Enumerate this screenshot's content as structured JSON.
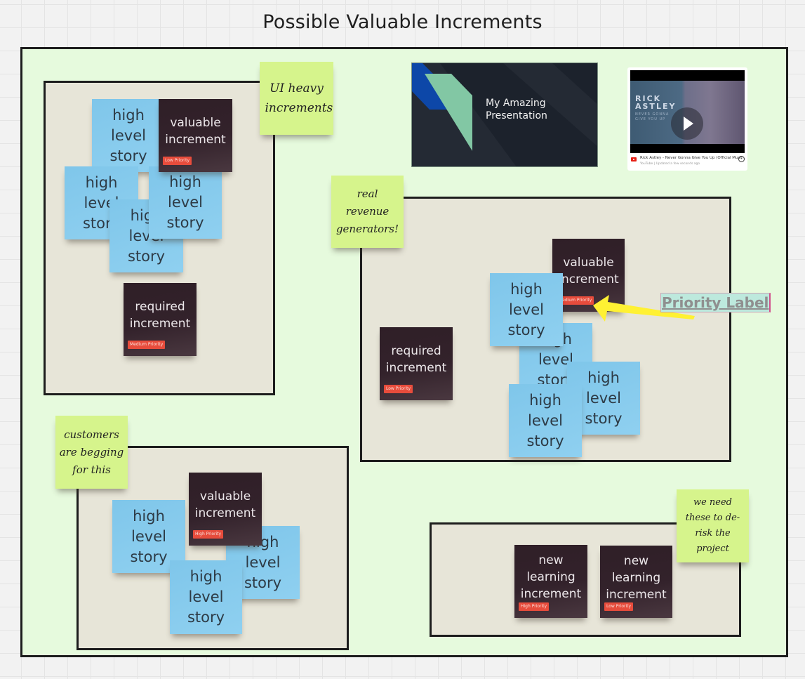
{
  "board": {
    "title": "Possible Valuable Increments",
    "colors": {
      "frame_bg": "#e6fadd",
      "group_bg": "#e7e5d8",
      "story_sticky": "#86c9eb",
      "increment_card": "#33222b",
      "note_sticky": "#d6f48c",
      "priority_badge": "#e74c3c",
      "arrow": "#fff133"
    }
  },
  "notes": {
    "ui_heavy": "UI heavy increments",
    "revenue": "real revenue generators!",
    "customers": "customers are begging for this",
    "derisk": "we need these to de-risk the project"
  },
  "story_label": "high level story",
  "groups": {
    "ui_heavy": {
      "valuable": {
        "label": "valuable increment",
        "priority": "Low Priority"
      },
      "required": {
        "label": "required increment",
        "priority": "Medium Priority"
      }
    },
    "revenue": {
      "valuable": {
        "label": "valuable increment",
        "priority": "Medium Priority"
      },
      "required": {
        "label": "required increment",
        "priority": "Low Priority"
      }
    },
    "customers": {
      "valuable": {
        "label": "valuable increment",
        "priority": "High Priority"
      }
    },
    "derisk": {
      "learning1": {
        "label": "new learning increment",
        "priority": "High Priority"
      },
      "learning2": {
        "label": "new learning increment",
        "priority": "Low Priority"
      }
    }
  },
  "presentation": {
    "title_line1": "My Amazing",
    "title_line2": "Presentation"
  },
  "video": {
    "thumb_name_line1": "RICK",
    "thumb_name_line2": "ASTLEY",
    "thumb_sub": "NEVER GONNA GIVE YOU UP",
    "title": "Rick Astley - Never Gonna Give You Up (Official Musi...",
    "source": "YouTube",
    "updated": "Updated a few seconds ago",
    "help_glyph": "?"
  },
  "annotation": {
    "label": "Priority Label"
  }
}
